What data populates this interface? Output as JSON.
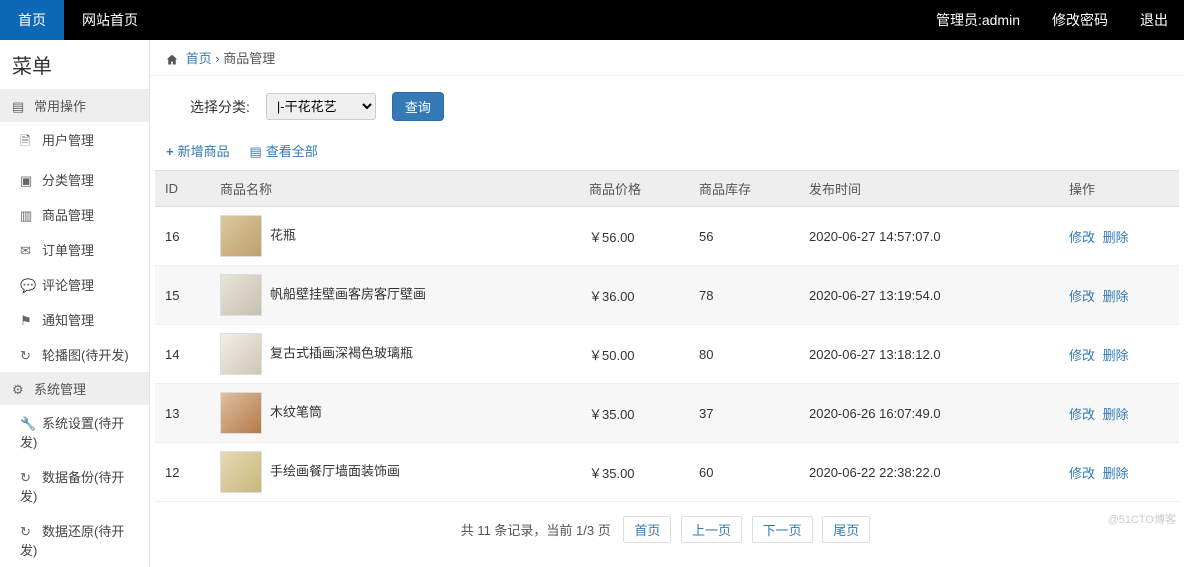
{
  "topbar": {
    "tab_home": "首页",
    "tab_site_home": "网站首页",
    "admin_label": "管理员:admin",
    "change_password": "修改密码",
    "logout": "退出"
  },
  "sidebar": {
    "menu_title": "菜单",
    "section_common": "常用操作",
    "items_common": [
      "用户管理",
      "分类管理",
      "商品管理",
      "订单管理",
      "评论管理",
      "通知管理",
      "轮播图(待开发)"
    ],
    "section_system": "系统管理",
    "items_system": [
      "系统设置(待开发)",
      "数据备份(待开发)",
      "数据还原(待开发)"
    ]
  },
  "breadcrumb": {
    "home": "首页",
    "current": "商品管理"
  },
  "filter": {
    "label": "选择分类:",
    "selected": "|-干花花艺",
    "query_btn": "查询"
  },
  "actions": {
    "add": "新增商品",
    "view_all": "查看全部"
  },
  "table": {
    "headers": {
      "id": "ID",
      "name": "商品名称",
      "price": "商品价格",
      "stock": "商品库存",
      "pubtime": "发布时间",
      "ops": "操作"
    },
    "rows": [
      {
        "id": "16",
        "name": "花瓶",
        "price": "￥56.00",
        "stock": "56",
        "pubtime": "2020-06-27 14:57:07.0",
        "thumb_class": "t1"
      },
      {
        "id": "15",
        "name": "帆船壁挂壁画客房客厅壁画",
        "price": "￥36.00",
        "stock": "78",
        "pubtime": "2020-06-27 13:19:54.0",
        "thumb_class": "t2"
      },
      {
        "id": "14",
        "name": "复古式插画深褐色玻璃瓶",
        "price": "￥50.00",
        "stock": "80",
        "pubtime": "2020-06-27 13:18:12.0",
        "thumb_class": "t3"
      },
      {
        "id": "13",
        "name": "木纹笔筒",
        "price": "￥35.00",
        "stock": "37",
        "pubtime": "2020-06-26 16:07:49.0",
        "thumb_class": "t4"
      },
      {
        "id": "12",
        "name": "手绘画餐厅墙面装饰画",
        "price": "￥35.00",
        "stock": "60",
        "pubtime": "2020-06-22 22:38:22.0",
        "thumb_class": "t5"
      }
    ],
    "op_edit": "修改",
    "op_delete": "删除"
  },
  "pagination": {
    "info": "共 11 条记录，当前 1/3 页",
    "first": "首页",
    "prev": "上一页",
    "next": "下一页",
    "last": "尾页"
  },
  "watermark": "@51CTO博客"
}
